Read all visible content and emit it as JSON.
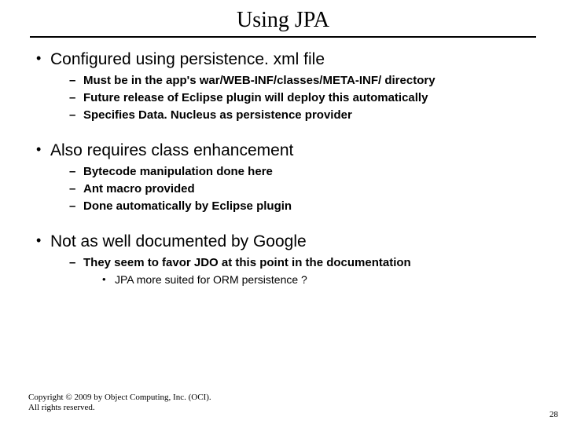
{
  "title": "Using JPA",
  "bullets": [
    {
      "text": "Configured using persistence. xml file",
      "sub": [
        {
          "text": "Must be in the app's war/WEB-INF/classes/META-INF/ directory"
        },
        {
          "text": "Future release of Eclipse plugin will deploy this automatically"
        },
        {
          "text": "Specifies Data. Nucleus as persistence provider"
        }
      ]
    },
    {
      "text": "Also requires class enhancement",
      "sub": [
        {
          "text": "Bytecode manipulation done here"
        },
        {
          "text": "Ant macro provided"
        },
        {
          "text": "Done automatically by Eclipse plugin"
        }
      ]
    },
    {
      "text": "Not as well documented by Google",
      "sub": [
        {
          "text": "They seem to favor JDO at this point in the documentation",
          "sub": [
            {
              "text": "JPA more suited for ORM persistence ?"
            }
          ]
        }
      ]
    }
  ],
  "footer": {
    "line1": "Copyright © 2009 by Object Computing, Inc. (OCI).",
    "line2": "All rights reserved."
  },
  "page_number": "28"
}
